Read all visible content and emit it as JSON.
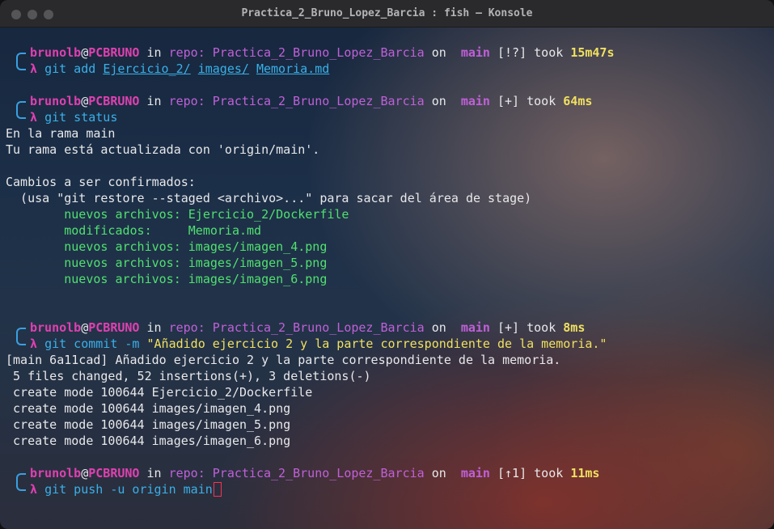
{
  "window": {
    "title": "Practica_2_Bruno_Lopez_Barcia : fish — Konsole"
  },
  "prompt": {
    "user": "brunolb",
    "at": "@",
    "host": "PCBRUNO",
    "in": "in",
    "repo_label": "repo:",
    "repo": "Practica_2_Bruno_Lopez_Barcia",
    "on": "on",
    "branch_icon": "",
    "branch": "main",
    "took": "took",
    "lambda": "λ"
  },
  "blocks": [
    {
      "status": "[!?]",
      "duration": "15m47s",
      "command": "git add",
      "args": [
        "Ejercicio_2/",
        "images/",
        "Memoria.md"
      ]
    },
    {
      "status": "[+]",
      "duration": "64ms",
      "command": "git status",
      "output": [
        "En la rama main",
        "Tu rama está actualizada con 'origin/main'.",
        "",
        "Cambios a ser confirmados:",
        "  (usa \"git restore --staged <archivo>...\" para sacar del área de stage)"
      ],
      "staged": [
        "        nuevos archivos: Ejercicio_2/Dockerfile",
        "        modificados:     Memoria.md",
        "        nuevos archivos: images/imagen_4.png",
        "        nuevos archivos: images/imagen_5.png",
        "        nuevos archivos: images/imagen_6.png"
      ]
    },
    {
      "status": "[+]",
      "duration": "8ms",
      "command": "git commit -m",
      "message": "\"Añadido ejercicio 2 y la parte correspondiente de la memoria.\"",
      "output": [
        "[main 6a11cad] Añadido ejercicio 2 y la parte correspondiente de la memoria.",
        " 5 files changed, 52 insertions(+), 3 deletions(-)",
        " create mode 100644 Ejercicio_2/Dockerfile",
        " create mode 100644 images/imagen_4.png",
        " create mode 100644 images/imagen_5.png",
        " create mode 100644 images/imagen_6.png"
      ]
    },
    {
      "status": "[↑1]",
      "duration": "11ms",
      "command": "git push -u origin main"
    }
  ]
}
